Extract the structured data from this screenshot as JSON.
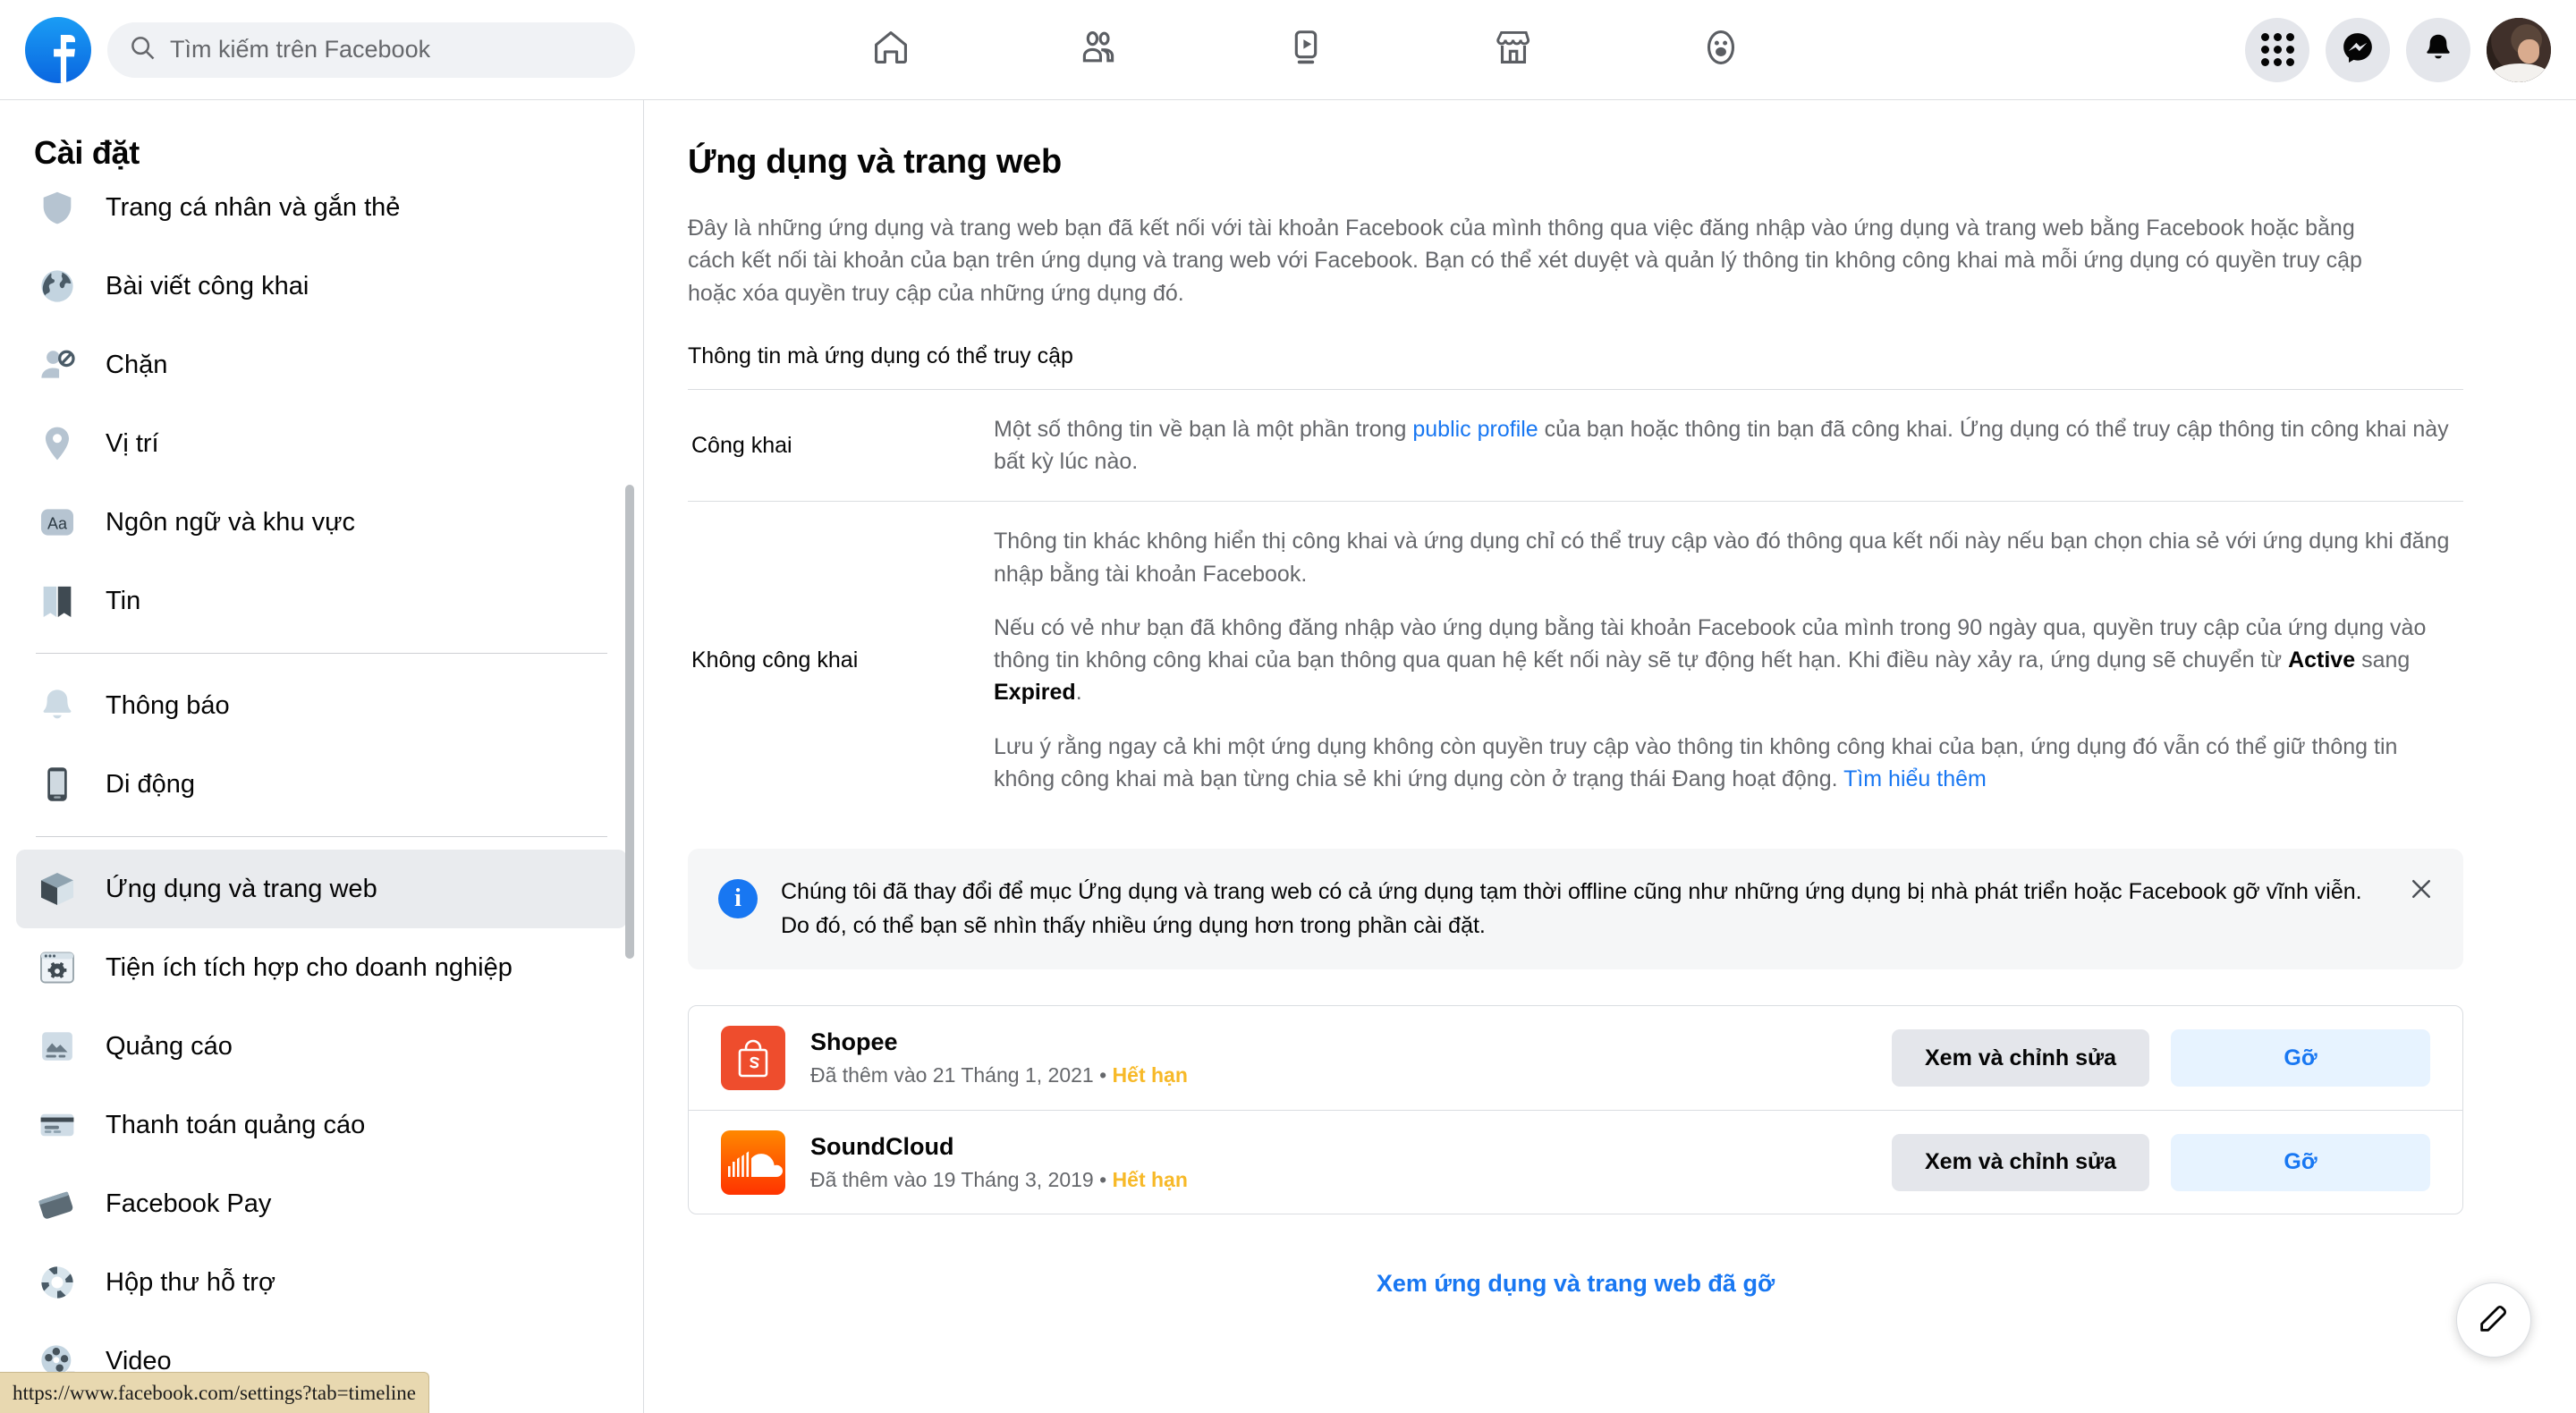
{
  "topbar": {
    "logo_name": "facebook-logo",
    "search": {
      "placeholder": "Tìm kiếm trên Facebook",
      "value": ""
    },
    "nav": [
      {
        "name": "home-icon",
        "label": "Trang chủ"
      },
      {
        "name": "friends-icon",
        "label": "Bạn bè"
      },
      {
        "name": "watch-icon",
        "label": "Watch"
      },
      {
        "name": "marketplace-icon",
        "label": "Marketplace"
      },
      {
        "name": "groups-icon",
        "label": "Nhóm"
      }
    ],
    "right": [
      {
        "name": "menu-grid-icon",
        "label": "Menu"
      },
      {
        "name": "messenger-icon",
        "label": "Messenger"
      },
      {
        "name": "notifications-bell-icon",
        "label": "Thông báo"
      },
      {
        "name": "avatar",
        "label": "Tài khoản"
      }
    ]
  },
  "sidebar": {
    "title": "Cài đặt",
    "items": [
      {
        "label": "Trang cá nhân và gắn thẻ",
        "icon": "profile-tag-icon",
        "active": false,
        "partial": true
      },
      {
        "label": "Bài viết công khai",
        "icon": "globe-icon",
        "active": false
      },
      {
        "label": "Chặn",
        "icon": "block-user-icon",
        "active": false
      },
      {
        "label": "Vị trí",
        "icon": "location-pin-icon",
        "active": false
      },
      {
        "label": "Ngôn ngữ và khu vực",
        "icon": "language-aa-icon",
        "active": false
      },
      {
        "label": "Tin",
        "icon": "stories-book-icon",
        "active": false
      },
      {
        "label": "Thông báo",
        "icon": "bell-icon",
        "active": false
      },
      {
        "label": "Di động",
        "icon": "mobile-phone-icon",
        "active": false
      },
      {
        "label": "Ứng dụng và trang web",
        "icon": "cube-icon",
        "active": true
      },
      {
        "label": "Tiện ích tích hợp cho doanh nghiệp",
        "icon": "business-integrations-icon",
        "active": false
      },
      {
        "label": "Quảng cáo",
        "icon": "ads-icon",
        "active": false
      },
      {
        "label": "Thanh toán quảng cáo",
        "icon": "credit-card-icon",
        "active": false
      },
      {
        "label": "Facebook Pay",
        "icon": "facebook-pay-icon",
        "active": false
      },
      {
        "label": "Hộp thư hỗ trợ",
        "icon": "support-lifebuoy-icon",
        "active": false
      },
      {
        "label": "Video",
        "icon": "film-reel-icon",
        "active": false
      }
    ],
    "dividers_after": [
      5,
      7
    ],
    "scrollbar_name": "sidebar-scrollbar"
  },
  "main": {
    "title": "Ứng dụng và trang web",
    "intro": "Đây là những ứng dụng và trang web bạn đã kết nối với tài khoản Facebook của mình thông qua việc đăng nhập vào ứng dụng và trang web bằng Facebook hoặc bằng cách kết nối tài khoản của bạn trên ứng dụng và trang web với Facebook. Bạn có thể xét duyệt và quản lý thông tin không công khai mà mỗi ứng dụng có quyền truy cập hoặc xóa quyền truy cập của những ứng dụng đó.",
    "section_label": "Thông tin mà ứng dụng có thể truy cập",
    "table": {
      "public": {
        "header": "Công khai",
        "text_before_link": "Một số thông tin về bạn là một phần trong ",
        "link": "public profile",
        "text_after_link": " của bạn hoặc thông tin bạn đã công khai. Ứng dụng có thể truy cập thông tin công khai này bất kỳ lúc nào."
      },
      "private": {
        "header": "Không công khai",
        "p1": "Thông tin khác không hiển thị công khai và ứng dụng chỉ có thể truy cập vào đó thông qua kết nối này nếu bạn chọn chia sẻ với ứng dụng khi đăng nhập bằng tài khoản Facebook.",
        "p2_a": "Nếu có vẻ như bạn đã không đăng nhập vào ứng dụng bằng tài khoản Facebook của mình trong 90 ngày qua, quyền truy cập của ứng dụng vào thông tin không công khai của bạn thông qua quan hệ kết nối này sẽ tự động hết hạn. Khi điều này xảy ra, ứng dụng sẽ chuyển từ ",
        "p2_bold1": "Active",
        "p2_b": " sang ",
        "p2_bold2": "Expired",
        "p2_c": ".",
        "p3_a": "Lưu ý rằng ngay cả khi một ứng dụng không còn quyền truy cập vào thông tin không công khai của bạn, ứng dụng đó vẫn có thể giữ thông tin không công khai mà bạn từng chia sẻ khi ứng dụng còn ở trạng thái Đang hoạt động. ",
        "p3_link": "Tìm hiểu thêm"
      }
    },
    "banner": {
      "icon": "info-icon",
      "text": "Chúng tôi đã thay đổi để mục Ứng dụng và trang web có cả ứng dụng tạm thời offline cũng như những ứng dụng bị nhà phát triển hoặc Facebook gỡ vĩnh viễn. Do đó, có thể bạn sẽ nhìn thấy nhiều ứng dụng hơn trong phần cài đặt.",
      "close_icon": "close-icon"
    },
    "apps": [
      {
        "name": "Shopee",
        "icon": "shopee-icon",
        "added_text": "Đã thêm vào 21 Tháng 1, 2021",
        "separator": "•",
        "status": "Hết hạn",
        "view_edit_label": "Xem và chỉnh sửa",
        "remove_label": "Gỡ"
      },
      {
        "name": "SoundCloud",
        "icon": "soundcloud-icon",
        "added_text": "Đã thêm vào 19 Tháng 3, 2019",
        "separator": "•",
        "status": "Hết hạn",
        "view_edit_label": "Xem và chỉnh sửa",
        "remove_label": "Gỡ"
      }
    ],
    "see_removed_label": "Xem ứng dụng và trang web đã gỡ"
  },
  "fab": {
    "icon": "compose-pencil-icon"
  },
  "statusbar": {
    "url": "https://www.facebook.com/settings?tab=timeline"
  },
  "colors": {
    "brand_blue": "#1877f2",
    "tint_bg": "#e7f3ff",
    "expired_amber": "#f7b928",
    "shopee_orange": "#ee4d2d",
    "grey_btn": "#e4e6eb",
    "text_secondary": "#65676b"
  }
}
